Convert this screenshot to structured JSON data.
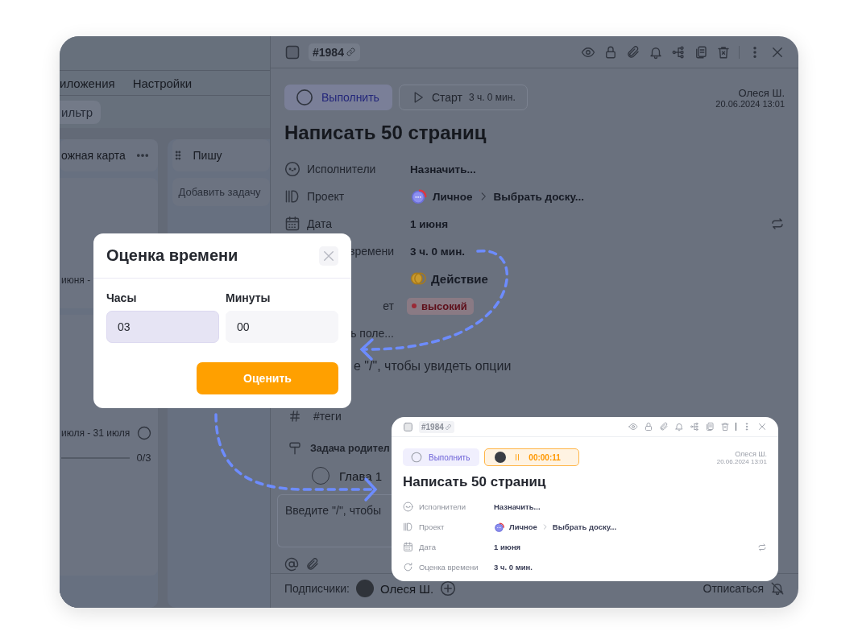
{
  "board": {
    "tabs": [
      "иложения",
      "Настройки"
    ],
    "filter_chip": "ильтр",
    "columns": [
      {
        "title": "ожная карта",
        "card_dates": [
          "июня -",
          "июля - 31 июля"
        ],
        "progress": "0/3"
      },
      {
        "title": "Пишу",
        "add_task": "Добавить задачу"
      }
    ]
  },
  "task": {
    "id": "#1984",
    "complete_button": "Выполнить",
    "start_button": {
      "label": "Старт",
      "estimate": "3 ч. 0 мин."
    },
    "author": "Олеся Ш.",
    "created": "20.06.2024 13:01",
    "title": "Написать 50 страниц",
    "fields": [
      {
        "kind": "assignee",
        "label": "Исполнители",
        "value": "Назначить...",
        "covered": false
      },
      {
        "kind": "project",
        "label": "Проект",
        "value": "Личное",
        "board": "Выбрать доску...",
        "covered": false
      },
      {
        "kind": "date",
        "label": "Дата",
        "value": "1 июня",
        "covered": false
      },
      {
        "kind": "estimate",
        "label": "времени",
        "value": "3 ч. 0 мин.",
        "covered": true
      },
      {
        "kind": "type",
        "value": "Действие"
      },
      {
        "kind": "priority",
        "label": "ет",
        "value": "высокий",
        "covered": true
      }
    ],
    "add_field": "ь поле...",
    "description_hint": "е \"/\", чтобы увидеть опции",
    "tags": "#теги",
    "parent_task": "Задача родител",
    "subtasks": [
      {
        "title": "Глава 1",
        "done": false
      }
    ],
    "comment_placeholder": "Введите \"/\", чтобы",
    "subscribers_label": "Подписчики:",
    "subscribers": [
      "Олеся Ш."
    ],
    "unsubscribe": "Отписаться"
  },
  "modal": {
    "title": "Оценка времени",
    "fields": [
      {
        "label": "Часы",
        "value": "03",
        "focused": true
      },
      {
        "label": "Минуты",
        "value": "00",
        "focused": false
      }
    ],
    "submit": "Оценить"
  },
  "inset": {
    "id": "#1984",
    "complete_button": "Выполнить",
    "timer": "00:00:11",
    "author": "Олеся Ш.",
    "created": "20.06.2024 13:01",
    "title": "Написать 50 страниц",
    "fields": [
      {
        "kind": "assignee",
        "label": "Исполнители",
        "value": "Назначить..."
      },
      {
        "kind": "project",
        "label": "Проект",
        "value": "Личное",
        "board": "Выбрать доску..."
      },
      {
        "kind": "date",
        "label": "Дата",
        "value": "1 июня"
      },
      {
        "kind": "estimate",
        "label": "Оценка времени",
        "value": "3 ч. 0 мин."
      }
    ]
  }
}
